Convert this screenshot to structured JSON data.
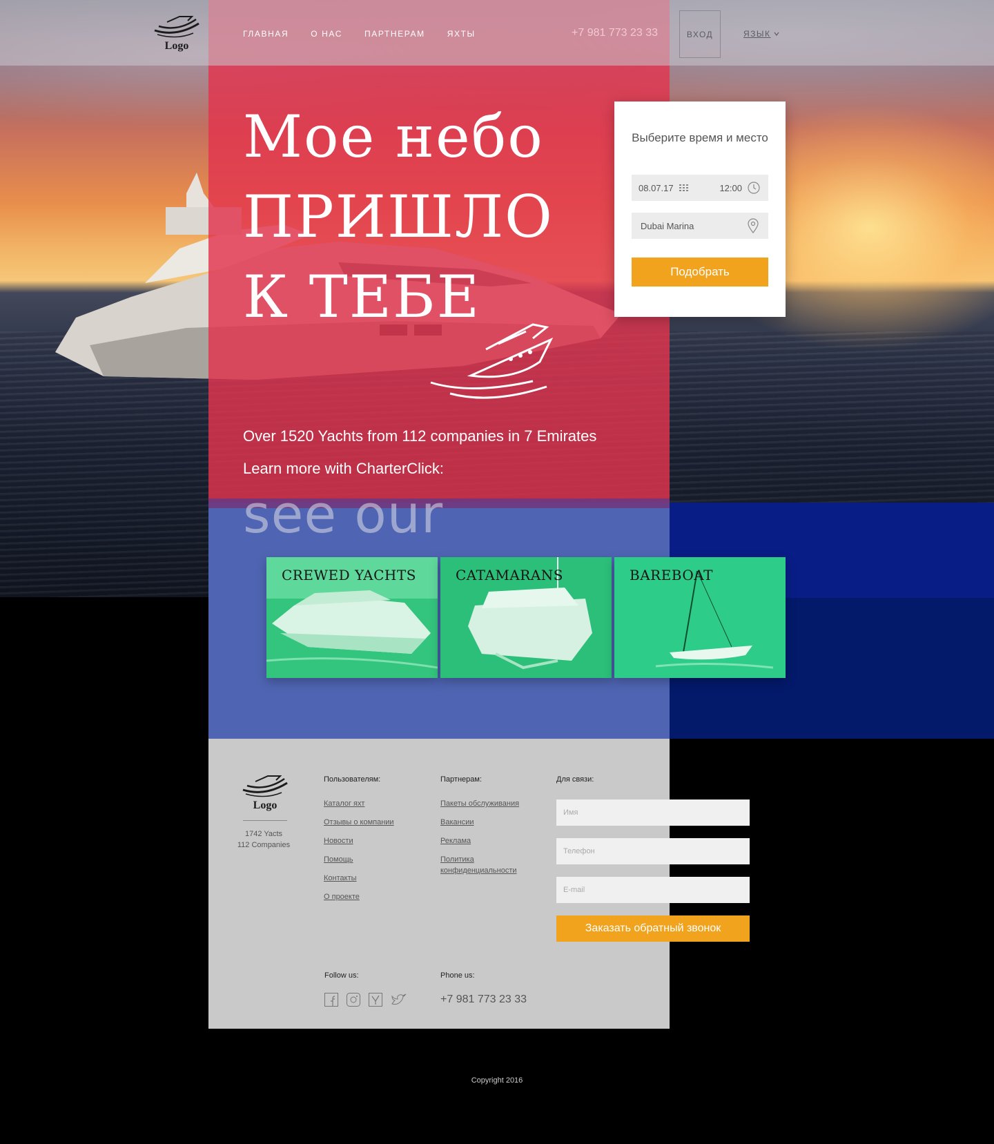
{
  "brand": {
    "logo_text": "Logo"
  },
  "nav": {
    "items": [
      "ГЛАВНАЯ",
      "О НАС",
      "ПАРТНЕРАМ",
      "ЯХТЫ"
    ]
  },
  "header": {
    "phone": "+7 981 773 23 33",
    "login_label": "ВХОД",
    "language_label": "ЯЗЫК"
  },
  "hero": {
    "title_line1": "Мое небо",
    "title_line2": "пришло",
    "title_line3": "к тебе",
    "tagline": "Over 1520 Yachts from 112 companies in 7 Emirates",
    "cta_text": "Learn more with CharterClick:",
    "section_heading": "see our"
  },
  "search_widget": {
    "title": "Выберите время и место",
    "date_value": "08.07.17",
    "time_value": "12:00",
    "location_value": "Dubai Marina",
    "submit_label": "Подобрать"
  },
  "categories": [
    {
      "label": "CREWED YACHTS"
    },
    {
      "label": "CATAMARANS"
    },
    {
      "label": "BAREBOAT"
    }
  ],
  "footer": {
    "logo_text": "Logo",
    "stats_yachts": "1742 Yacts",
    "stats_companies": "112 Companies",
    "users": {
      "title": "Пользователям:",
      "links": [
        "Каталог яхт",
        "Отзывы о компании",
        "Новости",
        "Помощь",
        "Контакты",
        "О проекте"
      ]
    },
    "partners": {
      "title": "Партнерам:",
      "links": [
        "Пакеты обслуживания",
        "Вакансии",
        "Реклама",
        "Политика конфиденциальности"
      ]
    },
    "contact": {
      "title": "Для связи:",
      "name_placeholder": "Имя",
      "phone_placeholder": "Телефон",
      "email_placeholder": "E-mail",
      "submit_label": "Заказать обратный звонок"
    },
    "follow_title": "Follow us:",
    "social_icons": [
      "facebook-icon",
      "instagram-icon",
      "yelp-icon",
      "twitter-icon"
    ],
    "phone_title": "Phone us:",
    "phone": "+7 981 773 23 33"
  },
  "copyright": "Copyright 2016",
  "colors": {
    "accent_orange": "#f2a31e",
    "overlay_red": "#e2344e",
    "band_blue": "#4f65b3",
    "band_navy": "#031a6b",
    "footer_gray": "#c9c9c9",
    "card_green": "#2fcf80"
  }
}
